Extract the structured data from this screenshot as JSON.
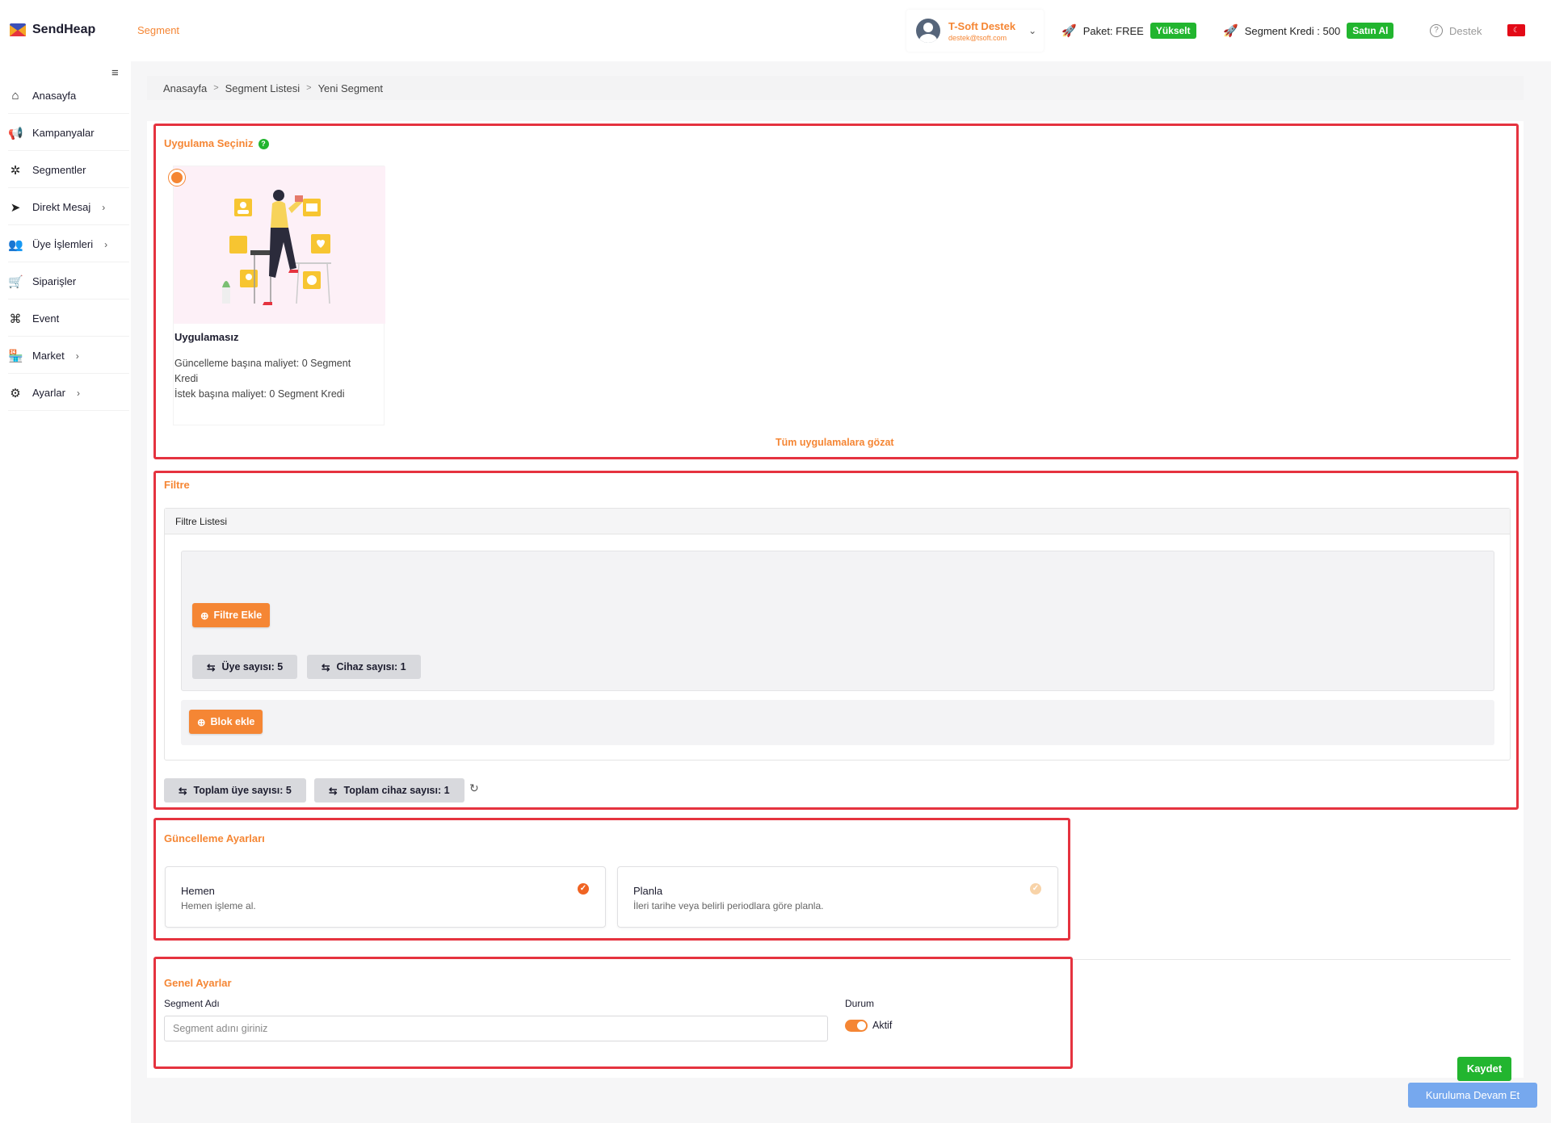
{
  "app": {
    "name": "SendHeap",
    "page_tag": "Segment"
  },
  "header": {
    "user_name": "T-Soft Destek",
    "user_email": "destek@tsoft.com",
    "package_label": "Paket: FREE",
    "upgrade_label": "Yükselt",
    "credit_label": "Segment Kredi : 500",
    "buy_label": "Satın Al",
    "support_label": "Destek",
    "language_flag": "tr"
  },
  "sidebar": {
    "items": [
      {
        "label": "Anasayfa",
        "icon": "home-icon"
      },
      {
        "label": "Kampanyalar",
        "icon": "megaphone-icon"
      },
      {
        "label": "Segmentler",
        "icon": "segments-icon"
      },
      {
        "label": "Direkt Mesaj",
        "icon": "send-icon"
      },
      {
        "label": "Üye İşlemleri",
        "icon": "users-icon"
      },
      {
        "label": "Siparişler",
        "icon": "cart-icon"
      },
      {
        "label": "Event",
        "icon": "command-icon"
      },
      {
        "label": "Market",
        "icon": "store-icon"
      },
      {
        "label": "Ayarlar",
        "icon": "gear-icon"
      }
    ]
  },
  "breadcrumb": {
    "items": [
      "Anasayfa",
      "Segment Listesi",
      "Yeni Segment"
    ],
    "separator": ">"
  },
  "app_select": {
    "title": "Uygulama Seçiniz",
    "card_name": "Uygulamasız",
    "cost_update": "Güncelleme başına maliyet: 0 Segment Kredi",
    "cost_request": "İstek başına maliyet: 0 Segment Kredi",
    "browse_label": "Tüm uygulamalara gözat"
  },
  "filter": {
    "title": "Filtre",
    "list_title": "Filtre Listesi",
    "add_filter_label": "Filtre Ekle",
    "member_count_label": "Üye sayısı: 5",
    "device_count_label": "Cihaz sayısı: 1",
    "add_block_label": "Blok ekle",
    "total_member_label": "Toplam üye sayısı: 5",
    "total_device_label": "Toplam cihaz sayısı: 1"
  },
  "update_settings": {
    "title": "Güncelleme Ayarları",
    "options": [
      {
        "title": "Hemen",
        "subtitle": "Hemen işleme al.",
        "selected": true
      },
      {
        "title": "Planla",
        "subtitle": "İleri tarihe veya belirli periodlara göre planla.",
        "selected": false
      }
    ]
  },
  "general_settings": {
    "title": "Genel Ayarlar",
    "name_label": "Segment Adı",
    "name_placeholder": "Segment adını giriniz",
    "name_value": "",
    "status_label": "Durum",
    "status_value": "Aktif",
    "status_on": true
  },
  "actions": {
    "save_label": "Kaydet",
    "continue_label": "Kuruluma Devam Et"
  },
  "colors": {
    "accent": "#f58634",
    "success": "#22b52f",
    "highlight": "#e5333f",
    "continue": "#76a8ee"
  }
}
